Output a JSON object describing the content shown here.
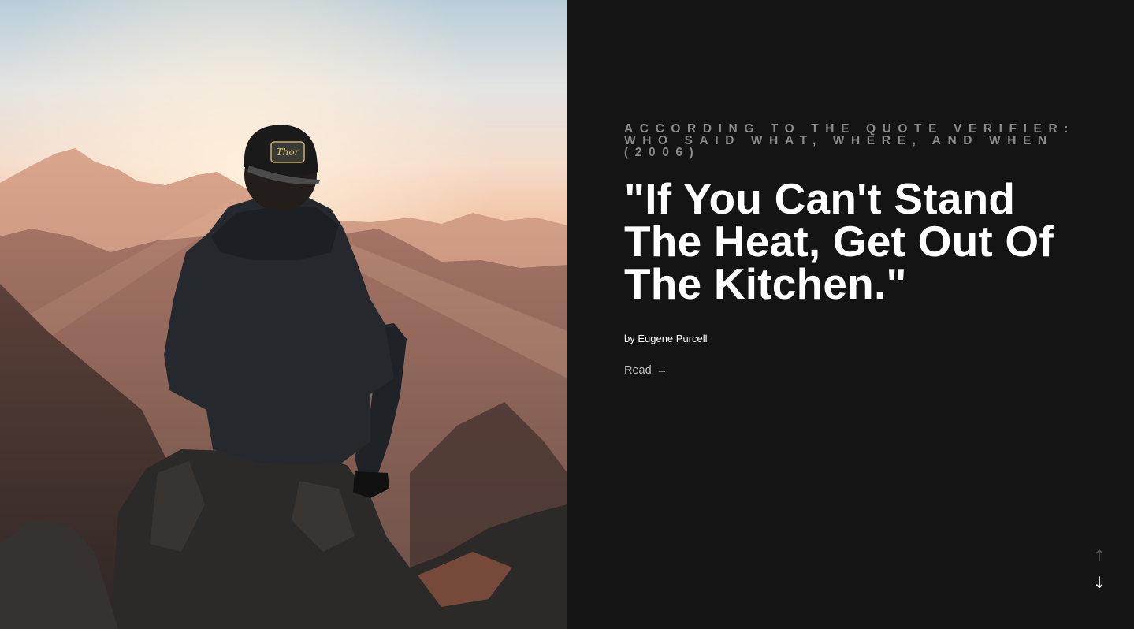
{
  "hero": {
    "image_alt": "person in hooded sweatshirt and cap sitting on a mountain rock at sunrise",
    "image_colors": {
      "sky_top": "#b9cdd9",
      "glow": "#f3d3bf",
      "haze": "#b88873",
      "shadow": "#2d2624"
    }
  },
  "quote": {
    "source": "According to The Quote Verifier: Who Said What, Where, and When (2006)",
    "text": "\"If You Can't Stand The Heat, Get Out Of The Kitchen.\"",
    "author": "by Eugene Purcell",
    "read_label": "Read",
    "read_icon": "arrow-right-icon",
    "read_arrow_glyph": "→"
  },
  "navigation": {
    "up_icon": "arrow-up-icon",
    "up_glyph": "↑",
    "down_icon": "arrow-down-icon",
    "down_glyph": "↓"
  },
  "colors": {
    "background": "#141414",
    "source_text": "#8a8a8a",
    "quote_text": "#ffffff",
    "read_text": "#bdbdbd"
  }
}
